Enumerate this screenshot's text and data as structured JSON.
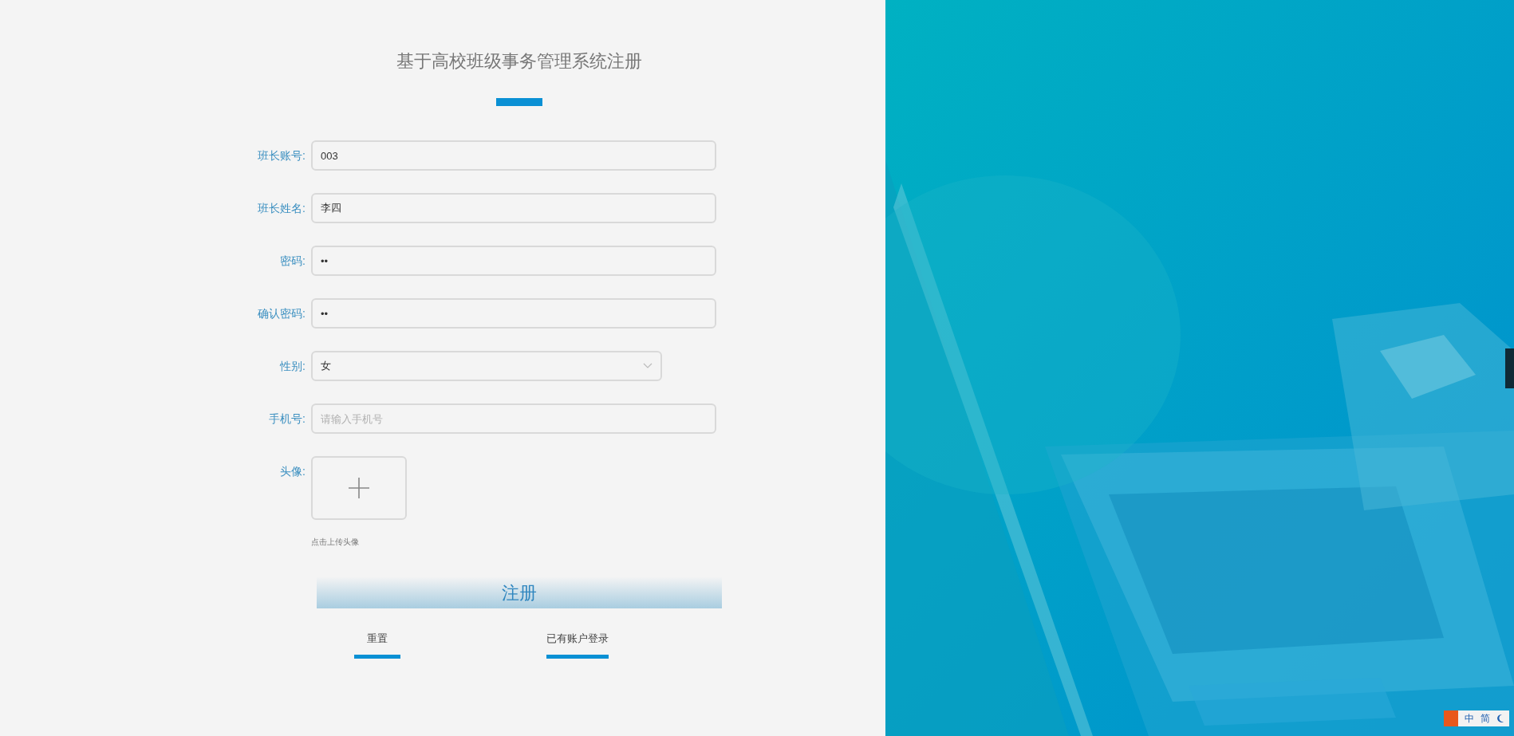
{
  "title": "基于高校班级事务管理系统注册",
  "fields": [
    {
      "kind": "input",
      "label": "班长账号:",
      "value": "003"
    },
    {
      "kind": "input",
      "label": "班长姓名:",
      "value": "李四"
    },
    {
      "kind": "input",
      "label": "密码:",
      "value": "••"
    },
    {
      "kind": "input",
      "label": "确认密码:",
      "value": "••"
    },
    {
      "kind": "select",
      "label": "性别:",
      "value": "女"
    },
    {
      "kind": "input",
      "label": "手机号:",
      "placeholder": "请输入手机号"
    },
    {
      "kind": "upload",
      "label": "头像:",
      "hint": "点击上传头像"
    }
  ],
  "submit": "注册",
  "links": [
    "重置",
    "已有账户登录"
  ],
  "ime_toolbar": {
    "items": [
      "中",
      "简"
    ]
  }
}
